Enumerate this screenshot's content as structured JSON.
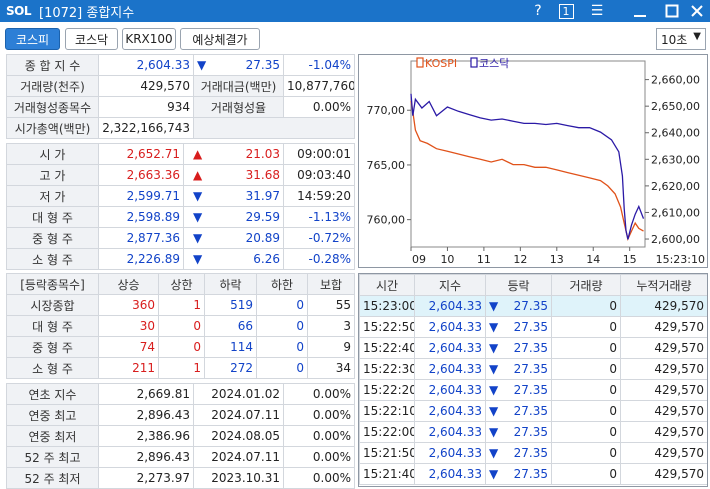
{
  "window": {
    "logo": "SOL",
    "title": "[1072] 종합지수",
    "help": "?",
    "number_box": "1",
    "menu_glyph": "☰"
  },
  "tabs": [
    {
      "label": "코스피",
      "active": true
    },
    {
      "label": "코스닥",
      "active": false
    },
    {
      "label": "KRX100",
      "active": false
    },
    {
      "label": "예상체결가",
      "active": false
    }
  ],
  "interval": {
    "value": "10초"
  },
  "summary": {
    "index_label": "종 합 지 수",
    "index_value": "2,604.33",
    "change": "27.35",
    "change_pct": "-1.04%",
    "volume_label": "거래량(천주)",
    "volume_value": "429,570",
    "amount_label": "거래대금(백만)",
    "amount_value": "10,877,760",
    "formed_label": "거래형성종목수",
    "formed_value": "934",
    "formed_rate_label": "거래형성율",
    "formed_rate_value": "0.00%",
    "mcap_label": "시가총액(백만)",
    "mcap_value": "2,322,166,743"
  },
  "ohlc": [
    {
      "label": "시  가",
      "value": "2,652.71",
      "dir": "up",
      "diff": "21.03",
      "time": "09:00:01",
      "color": "red"
    },
    {
      "label": "고  가",
      "value": "2,663.36",
      "dir": "up",
      "diff": "31.68",
      "time": "09:03:40",
      "color": "red"
    },
    {
      "label": "저  가",
      "value": "2,599.71",
      "dir": "dn",
      "diff": "31.97",
      "time": "14:59:20",
      "color": "blue"
    },
    {
      "label": "대 형 주",
      "value": "2,598.89",
      "dir": "dn",
      "diff": "29.59",
      "time": "-1.13%",
      "color": "blue"
    },
    {
      "label": "중 형 주",
      "value": "2,877.36",
      "dir": "dn",
      "diff": "20.89",
      "time": "-0.72%",
      "color": "blue"
    },
    {
      "label": "소 형 주",
      "value": "2,226.89",
      "dir": "dn",
      "diff": "6.26",
      "time": "-0.28%",
      "color": "blue"
    }
  ],
  "breadth": {
    "headers": [
      "[등락종목수]",
      "상승",
      "상한",
      "하락",
      "하한",
      "보합"
    ],
    "rows": [
      {
        "label": "시장종합",
        "up": "360",
        "upper": "1",
        "down": "519",
        "lower": "0",
        "flat": "55"
      },
      {
        "label": "대 형 주",
        "up": "30",
        "upper": "0",
        "down": "66",
        "lower": "0",
        "flat": "3"
      },
      {
        "label": "중 형 주",
        "up": "74",
        "upper": "0",
        "down": "114",
        "lower": "0",
        "flat": "9"
      },
      {
        "label": "소 형 주",
        "up": "211",
        "upper": "1",
        "down": "272",
        "lower": "0",
        "flat": "34"
      }
    ]
  },
  "yearly": [
    {
      "label": "연초  지수",
      "value": "2,669.81",
      "date": "2024.01.02",
      "pct": "0.00%"
    },
    {
      "label": "연중  최고",
      "value": "2,896.43",
      "date": "2024.07.11",
      "pct": "0.00%"
    },
    {
      "label": "연중  최저",
      "value": "2,386.96",
      "date": "2024.08.05",
      "pct": "0.00%"
    },
    {
      "label": "52 주 최고",
      "value": "2,896.43",
      "date": "2024.07.11",
      "pct": "0.00%"
    },
    {
      "label": "52 주 최저",
      "value": "2,273.97",
      "date": "2023.10.31",
      "pct": "0.00%"
    }
  ],
  "chart_data": {
    "type": "line",
    "legend": [
      "KOSPI",
      "코스닥"
    ],
    "legend_placement": "top-left",
    "x_ticks": [
      "09",
      "10",
      "11",
      "12",
      "13",
      "14",
      "15"
    ],
    "x_end_label": "15:23:10",
    "left_axis": {
      "ticks": [
        "770,00",
        "765,00",
        "760,00"
      ],
      "range": [
        757.5,
        774.5
      ]
    },
    "right_axis": {
      "ticks": [
        "2,660,00",
        "2,650,00",
        "2,640,00",
        "2,630,00",
        "2,620,00",
        "2,610,00",
        "2,600,00"
      ],
      "range": [
        2597,
        2667
      ]
    },
    "colors": {
      "kospi": "#e0521a",
      "kosdaq": "#2b1aa6"
    },
    "series": [
      {
        "name": "KOSPI",
        "axis": "right",
        "x": [
          9.0,
          9.05,
          9.12,
          9.25,
          9.45,
          9.7,
          10.0,
          10.3,
          10.6,
          10.9,
          11.2,
          11.5,
          11.8,
          12.1,
          12.4,
          12.7,
          13.0,
          13.3,
          13.6,
          13.9,
          14.2,
          14.4,
          14.6,
          14.75,
          14.85,
          14.95,
          15.05,
          15.15,
          15.25,
          15.38
        ],
        "y": [
          2652,
          2648,
          2641,
          2637,
          2636,
          2634,
          2633,
          2632,
          2631,
          2630,
          2629,
          2630,
          2628,
          2628,
          2627,
          2627,
          2626,
          2625,
          2624,
          2623,
          2622,
          2620,
          2617,
          2612,
          2606,
          2600,
          2603,
          2606,
          2604,
          2603
        ]
      },
      {
        "name": "코스닥",
        "axis": "left",
        "x": [
          9.0,
          9.05,
          9.12,
          9.3,
          9.5,
          9.7,
          10.0,
          10.3,
          10.6,
          10.9,
          11.2,
          11.5,
          11.8,
          12.1,
          12.4,
          12.7,
          13.0,
          13.3,
          13.6,
          13.9,
          14.2,
          14.5,
          14.7,
          14.8,
          14.85,
          14.9,
          14.95,
          15.05,
          15.15,
          15.25,
          15.38
        ],
        "y": [
          771.5,
          769.5,
          771.0,
          770.2,
          770.8,
          769.5,
          770.3,
          769.9,
          769.6,
          769.3,
          769.1,
          769.2,
          769.0,
          768.8,
          768.8,
          768.7,
          768.8,
          768.6,
          768.4,
          768.4,
          768.0,
          767.3,
          766.2,
          764.0,
          761.0,
          759.0,
          758.2,
          759.5,
          760.5,
          761.2,
          760.1
        ]
      }
    ]
  },
  "ticks": {
    "headers": [
      "시간",
      "지수",
      "등락",
      "거래량",
      "누적거래량"
    ],
    "rows": [
      {
        "time": "15:23:00",
        "index": "2,604.33",
        "diff": "27.35",
        "vol": "0",
        "cum": "429,570"
      },
      {
        "time": "15:22:50",
        "index": "2,604.33",
        "diff": "27.35",
        "vol": "0",
        "cum": "429,570"
      },
      {
        "time": "15:22:40",
        "index": "2,604.33",
        "diff": "27.35",
        "vol": "0",
        "cum": "429,570"
      },
      {
        "time": "15:22:30",
        "index": "2,604.33",
        "diff": "27.35",
        "vol": "0",
        "cum": "429,570"
      },
      {
        "time": "15:22:20",
        "index": "2,604.33",
        "diff": "27.35",
        "vol": "0",
        "cum": "429,570"
      },
      {
        "time": "15:22:10",
        "index": "2,604.33",
        "diff": "27.35",
        "vol": "0",
        "cum": "429,570"
      },
      {
        "time": "15:22:00",
        "index": "2,604.33",
        "diff": "27.35",
        "vol": "0",
        "cum": "429,570"
      },
      {
        "time": "15:21:50",
        "index": "2,604.33",
        "diff": "27.35",
        "vol": "0",
        "cum": "429,570"
      },
      {
        "time": "15:21:40",
        "index": "2,604.33",
        "diff": "27.35",
        "vol": "0",
        "cum": "429,570"
      }
    ]
  }
}
